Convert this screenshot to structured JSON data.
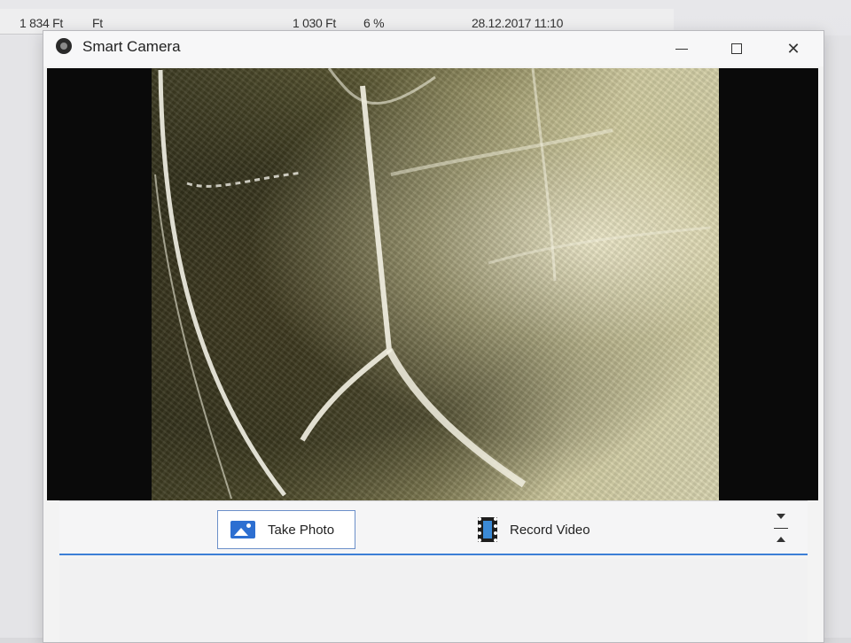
{
  "background": {
    "cell_1": "1 834 Ft",
    "cell_2": "Ft",
    "cell_3": "1 030 Ft",
    "cell_4": "6 %",
    "cell_5": "28.12.2017 11:10"
  },
  "window": {
    "title": "Smart Camera",
    "icon": "camera-icon",
    "minimize_icon": "minimize-icon",
    "maximize_icon": "maximize-icon",
    "close_icon": "close-icon",
    "close_glyph": "✕"
  },
  "controls": {
    "take_photo_label": "Take Photo",
    "take_photo_icon": "picture-icon",
    "record_video_label": "Record Video",
    "record_video_icon": "film-icon",
    "collapse_icon": "collapse-toggle-icon"
  },
  "colors": {
    "accent": "#3c7fd6",
    "photo_icon": "#2d6fd1"
  }
}
